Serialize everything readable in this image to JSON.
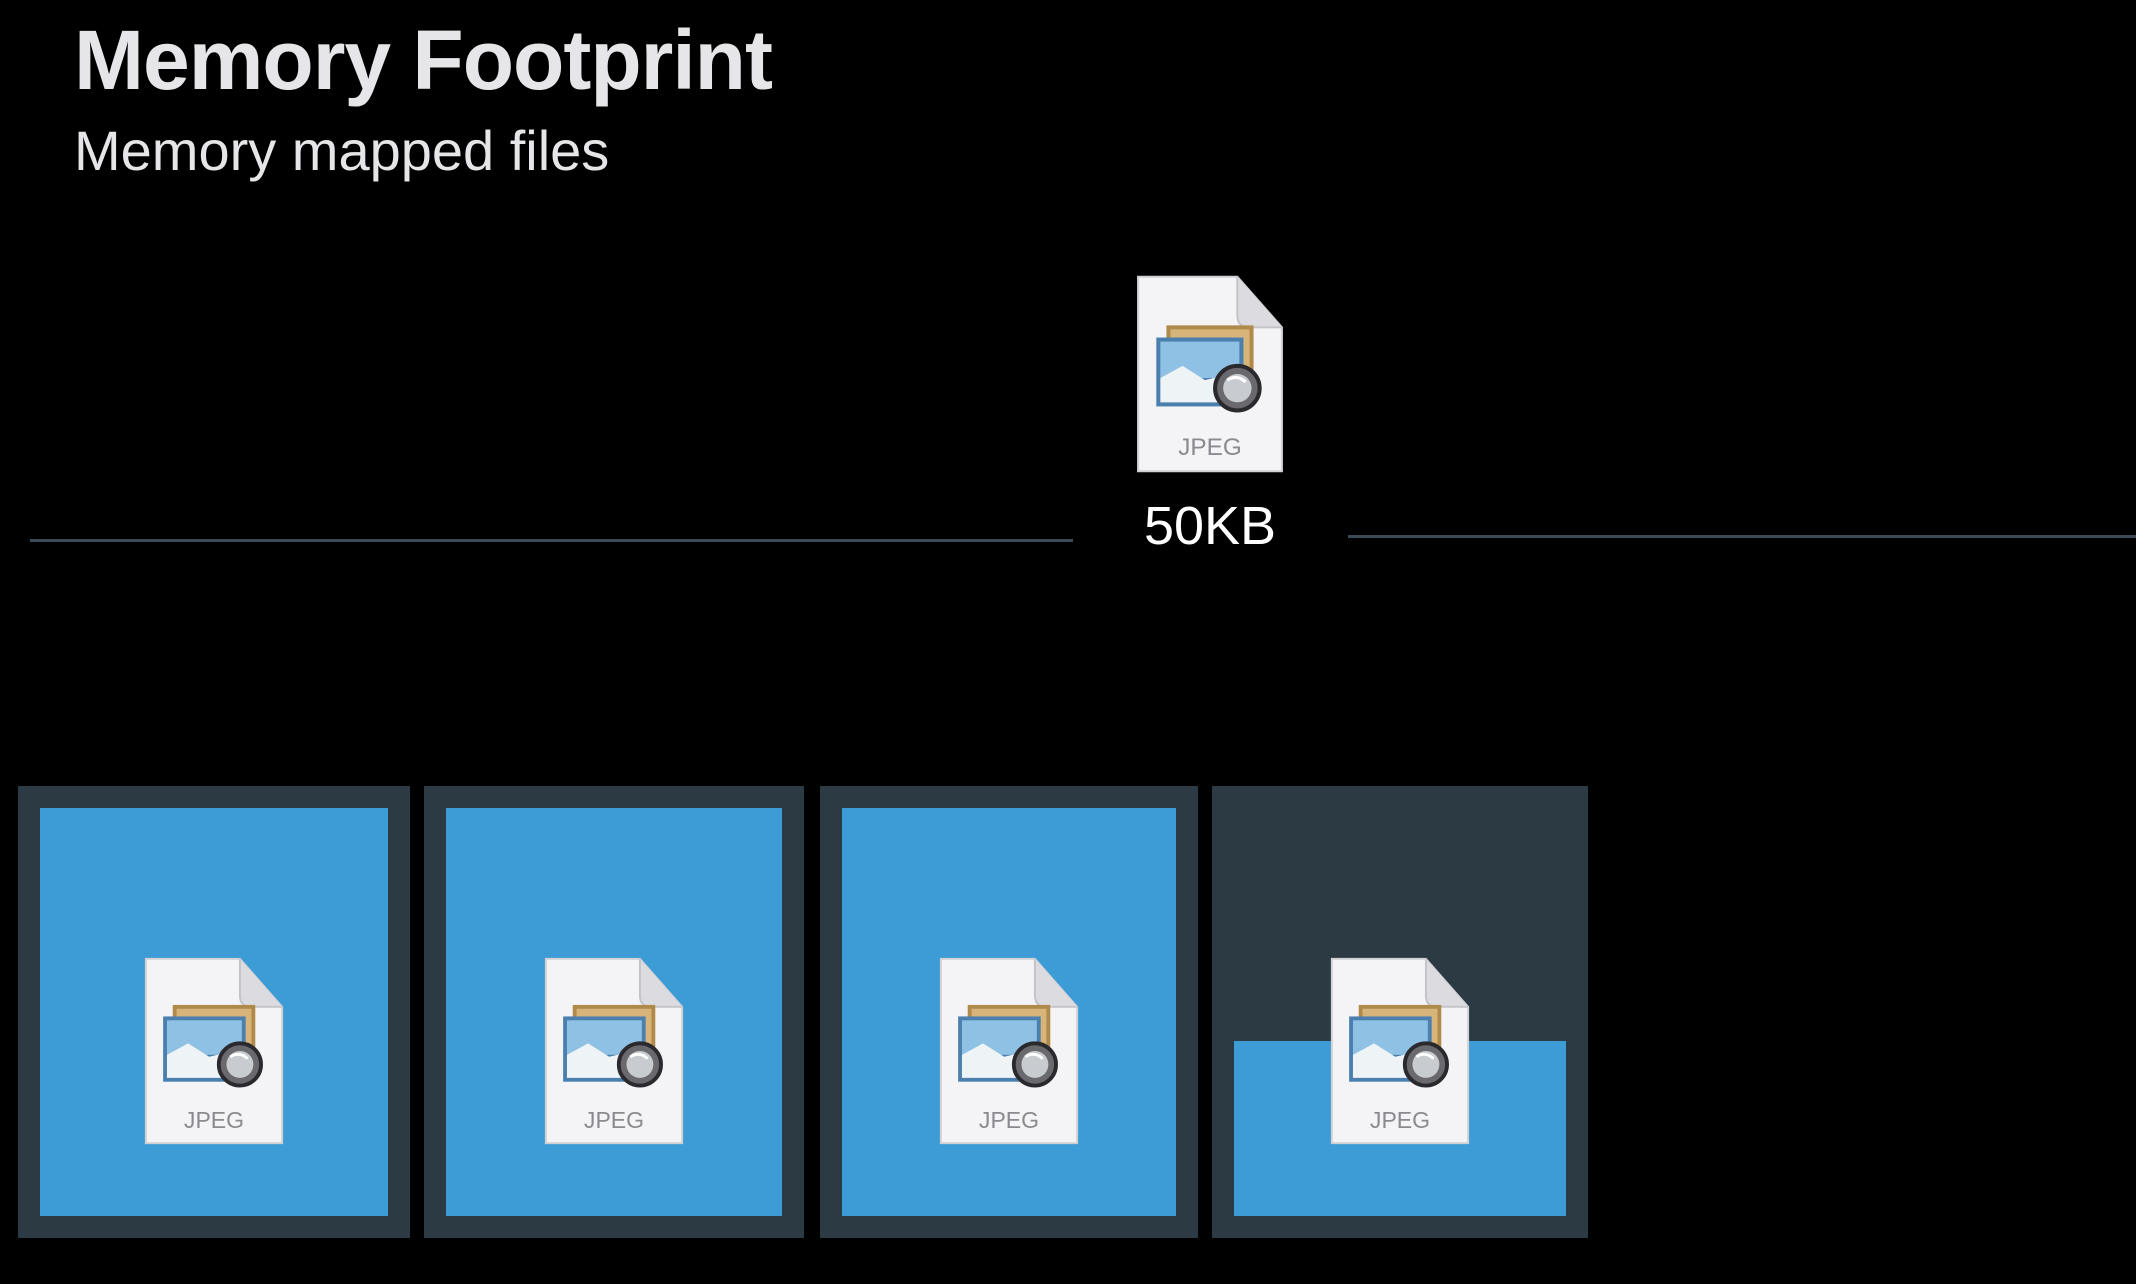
{
  "header": {
    "title": "Memory Footprint",
    "subtitle": "Memory mapped files"
  },
  "file": {
    "type_label": "JPEG",
    "size_label": "50KB",
    "icon": "jpeg-file-icon"
  },
  "pages": [
    {
      "label": "JPEG",
      "fill": 1.0
    },
    {
      "label": "JPEG",
      "fill": 1.0
    },
    {
      "label": "JPEG",
      "fill": 1.0
    },
    {
      "label": "JPEG",
      "fill": 0.43
    }
  ],
  "colors": {
    "background": "#000000",
    "page_slot": "#2c3a44",
    "page_fill": "#3d9bd6",
    "divider": "#3a4a56",
    "text": "#e6e6e8"
  }
}
